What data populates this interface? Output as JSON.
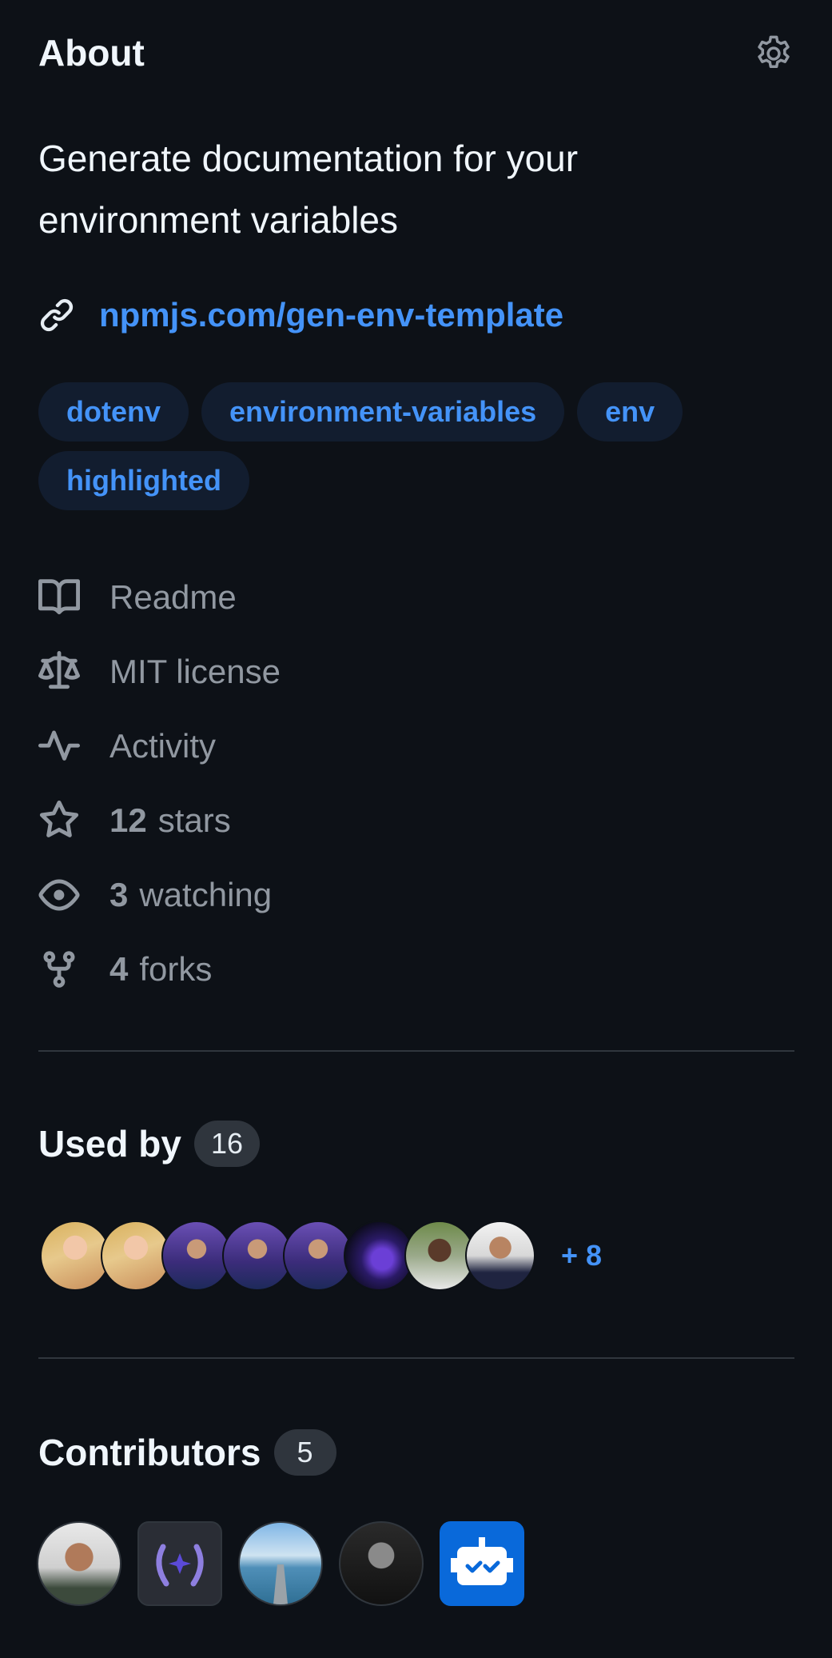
{
  "about": {
    "title": "About",
    "description": "Generate documentation for your environment variables",
    "link": "npmjs.com/gen-env-template",
    "topics": [
      "dotenv",
      "environment-variables",
      "env",
      "highlighted"
    ]
  },
  "meta": {
    "readme": "Readme",
    "license": "MIT license",
    "activity": "Activity",
    "stars_count": "12",
    "stars_label": "stars",
    "watching_count": "3",
    "watching_label": "watching",
    "forks_count": "4",
    "forks_label": "forks"
  },
  "used_by": {
    "title": "Used by",
    "count": "16",
    "more": "+ 8"
  },
  "contributors": {
    "title": "Contributors",
    "count": "5"
  },
  "colors": {
    "background": "#0d1117",
    "link": "#4493f8",
    "muted": "#9198a1",
    "topic_bg": "#121d2f"
  }
}
